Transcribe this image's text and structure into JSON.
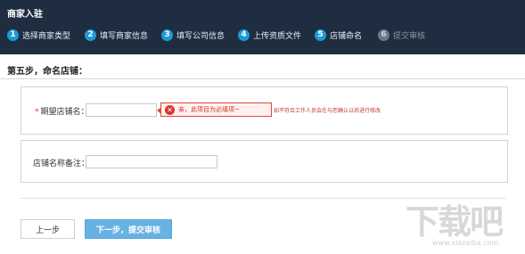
{
  "header": {
    "title": "商家入驻",
    "steps": [
      {
        "num": "1",
        "label": "选择商家类型",
        "state": "done"
      },
      {
        "num": "2",
        "label": "填写商家信息",
        "state": "done"
      },
      {
        "num": "3",
        "label": "填写公司信息",
        "state": "done"
      },
      {
        "num": "4",
        "label": "上传资质文件",
        "state": "done"
      },
      {
        "num": "5",
        "label": "店铺命名",
        "state": "current"
      },
      {
        "num": "6",
        "label": "提交审核",
        "state": "disabled"
      }
    ]
  },
  "section": {
    "title": "第五步，命名店铺："
  },
  "form": {
    "shop_name": {
      "required_mark": "*",
      "label": "期望店铺名：",
      "value": "",
      "error": "亲，此项目为必填项~",
      "hint": "如不符合工作人员会在与您确认以后进行修改"
    },
    "shop_note": {
      "label": "店铺名称备注：",
      "value": ""
    }
  },
  "buttons": {
    "prev": "上一步",
    "next": "下一步，提交审核"
  },
  "watermark": {
    "text": "下载吧",
    "url": "www.xiazaiba.com"
  },
  "colors": {
    "header_bg": "#1e2e40",
    "step_accent": "#1d9bd8",
    "error": "#d8362c",
    "primary_button": "#67b2e3"
  }
}
